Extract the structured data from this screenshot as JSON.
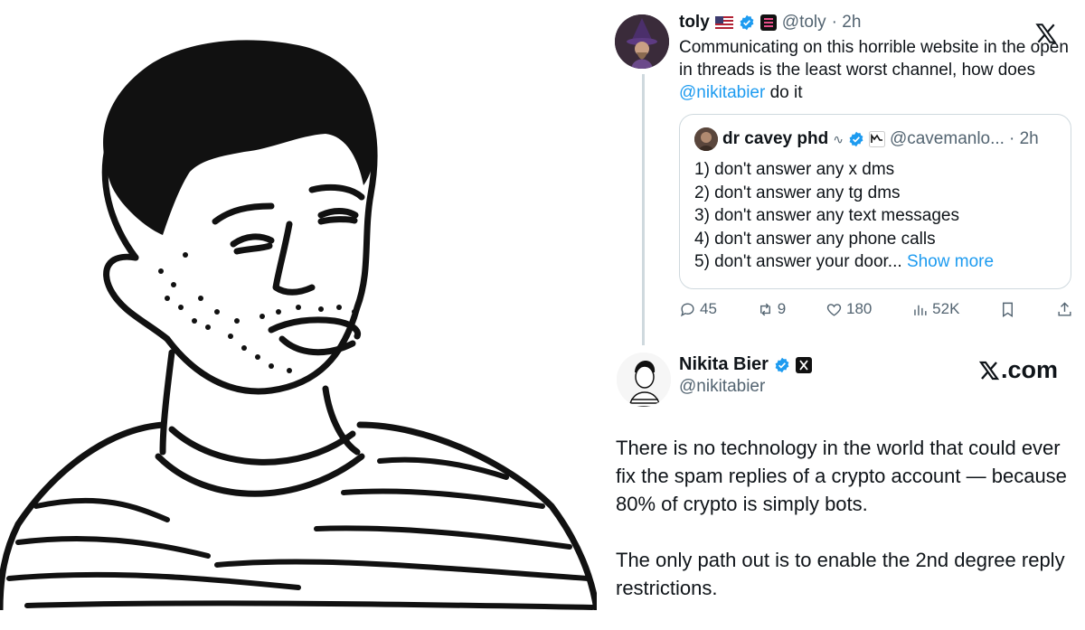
{
  "main_tweet": {
    "name": "toly",
    "handle": "@toly",
    "time": "· 2h",
    "text_before": "Communicating on this horrible website in the open in threads is the least worst channel, how does ",
    "mention": "@nikitabier",
    "text_after": " do it",
    "icons": [
      "us-flag-icon",
      "verified-badge-icon",
      "solana-badge-icon",
      "x-logo-icon"
    ]
  },
  "quoted_tweet": {
    "name": "dr cavey phd",
    "handle": "@cavemanlo...",
    "time": "· 2h",
    "lines": [
      "1) don't answer any x dms",
      "2) don't answer any tg dms",
      "3) don't answer any text messages",
      "4) don't answer any phone calls",
      "5) don't answer your door..."
    ],
    "show_more": "Show more"
  },
  "actions": {
    "replies": "45",
    "reposts": "9",
    "likes": "180",
    "views": "52K"
  },
  "reply": {
    "name": "Nikita Bier",
    "handle": "@nikitabier",
    "brand": ".com",
    "paragraphs": [
      "There is no technology in the world that could ever fix the spam replies of a crypto account — because 80% of crypto is simply bots.",
      "The only path out is to enable the 2nd degree reply restrictions."
    ]
  },
  "colors": {
    "accent": "#1d9bf0",
    "text": "#0f1419",
    "muted": "#536471",
    "border": "#cfd9de"
  }
}
